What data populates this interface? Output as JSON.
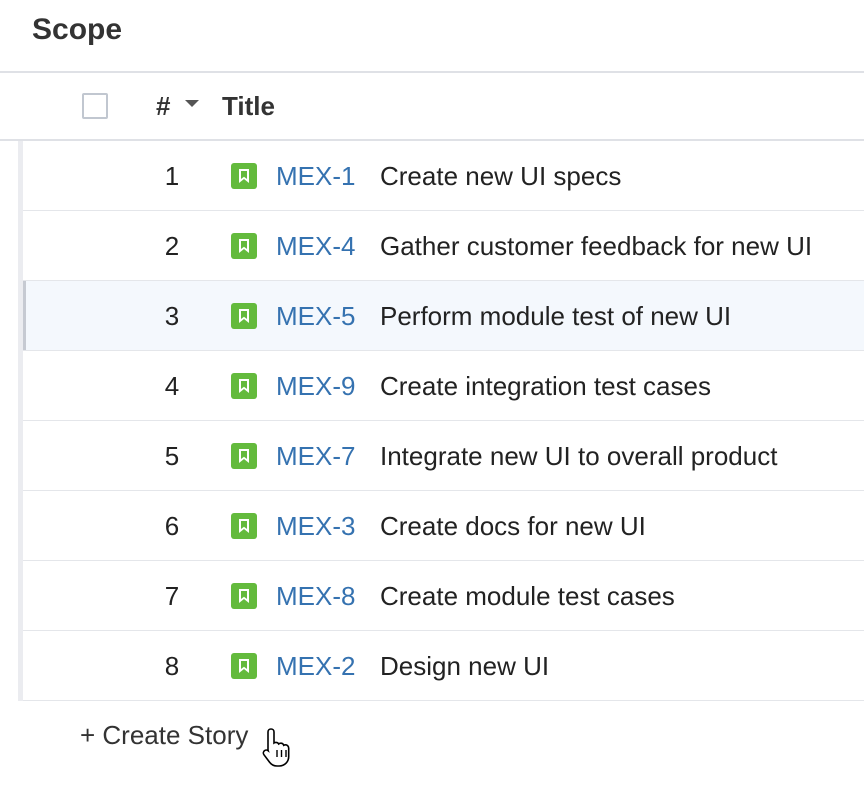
{
  "page": {
    "title": "Scope"
  },
  "table": {
    "header": {
      "num_label": "#",
      "title_label": "Title"
    },
    "rows": [
      {
        "rank": "1",
        "key": "MEX-1",
        "summary": "Create new UI specs"
      },
      {
        "rank": "2",
        "key": "MEX-4",
        "summary": "Gather customer feedback for new UI"
      },
      {
        "rank": "3",
        "key": "MEX-5",
        "summary": "Perform module test of new UI"
      },
      {
        "rank": "4",
        "key": "MEX-9",
        "summary": "Create integration test cases"
      },
      {
        "rank": "5",
        "key": "MEX-7",
        "summary": "Integrate new UI to overall product"
      },
      {
        "rank": "6",
        "key": "MEX-3",
        "summary": "Create docs for new UI"
      },
      {
        "rank": "7",
        "key": "MEX-8",
        "summary": "Create module test cases"
      },
      {
        "rank": "8",
        "key": "MEX-2",
        "summary": "Design new UI"
      }
    ],
    "hovered_row": "3"
  },
  "actions": {
    "create_label": "+ Create Story"
  },
  "icons": {
    "issue_type": "story-icon",
    "sort": "caret-down-icon",
    "pointer": "hand-pointer-icon"
  },
  "colors": {
    "link": "#3572b0",
    "story_icon": "#63ba3c",
    "hover_row": "#f4f8fd"
  }
}
